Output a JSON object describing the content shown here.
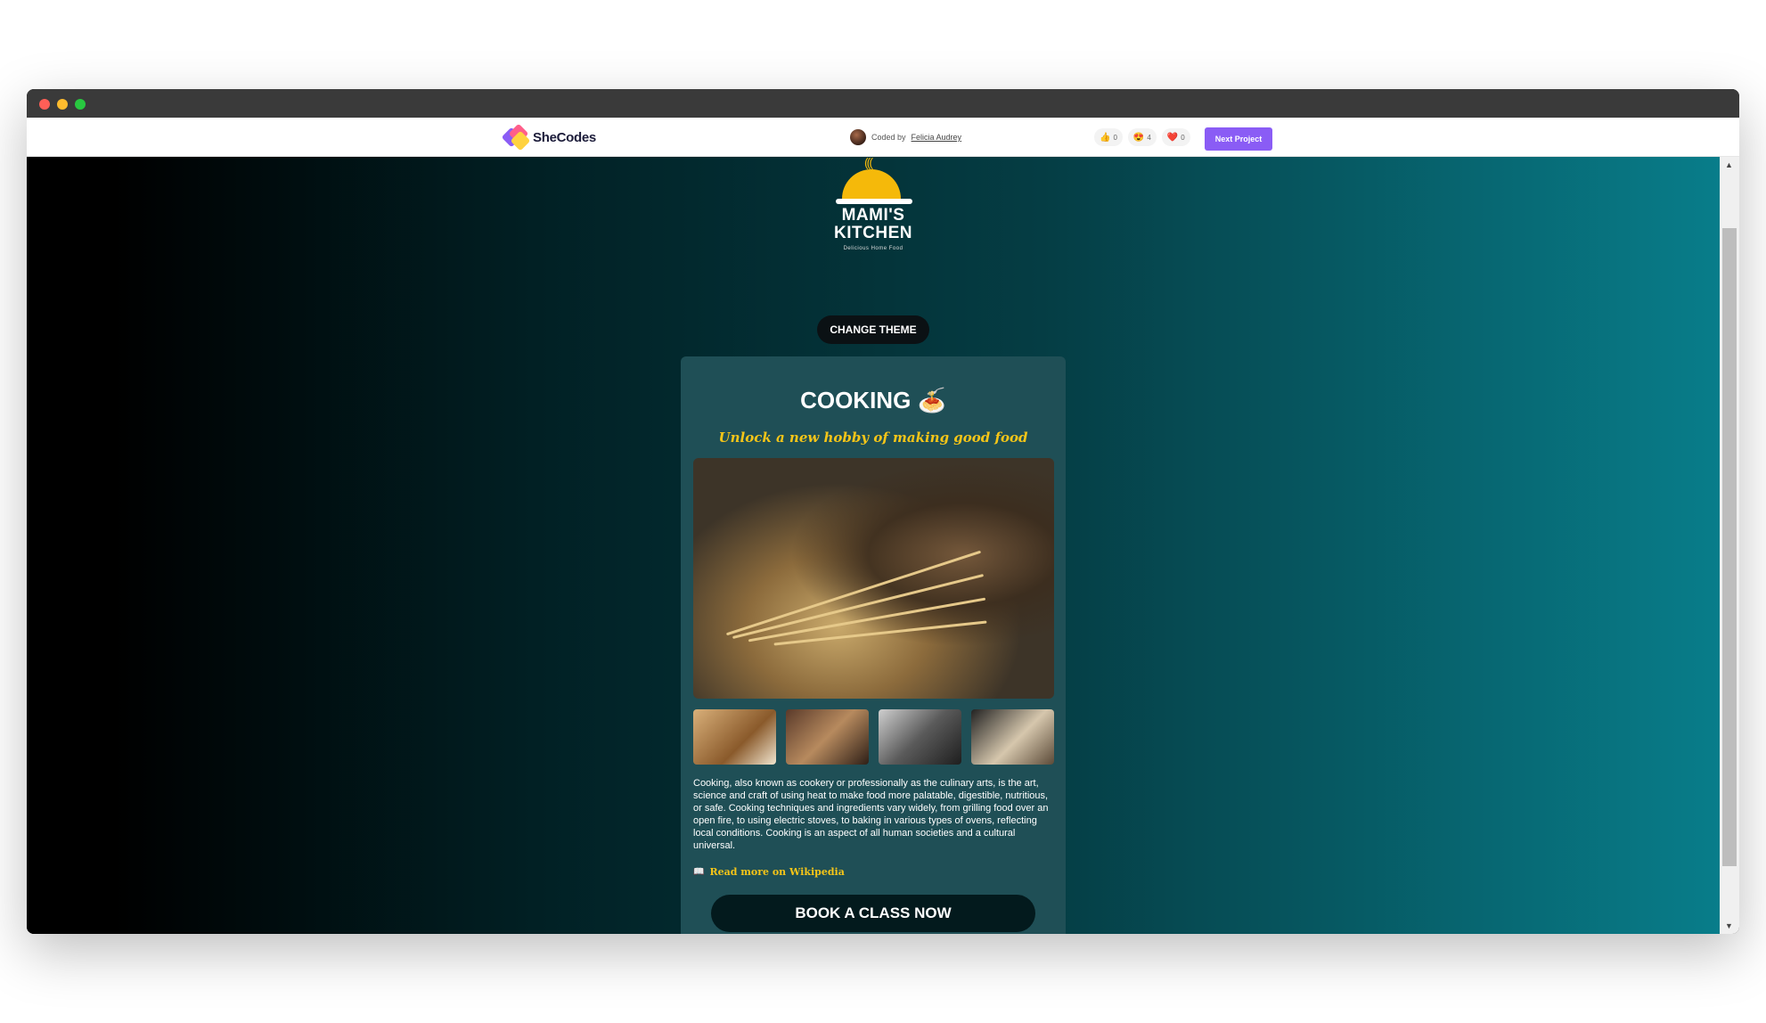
{
  "shecodes": {
    "logo_text": "SheCodes",
    "coded_by_prefix": "Coded by",
    "author": "Felicia Audrey",
    "reactions": [
      {
        "icon": "thumbs-up-icon",
        "emoji": "👍",
        "count": "0"
      },
      {
        "icon": "heart-eyes-icon",
        "emoji": "😍",
        "count": "4"
      },
      {
        "icon": "heart-icon",
        "emoji": "❤️",
        "count": "0"
      }
    ],
    "next_label": "Next Project"
  },
  "brand": {
    "steam": "(((",
    "name_line1": "MAMI'S",
    "name_line2": "KITCHEN",
    "tagline": "Delicious Home Food"
  },
  "theme_button": "CHANGE THEME",
  "card": {
    "title": "COOKING 🍝",
    "subtitle": "Unlock a new hobby of making good food",
    "description": "Cooking, also known as cookery or professionally as the culinary arts, is the art, science and craft of using heat to make food more palatable, digestible, nutritious, or safe. Cooking techniques and ingredients vary widely, from grilling food over an open fire, to using electric stoves, to baking in various types of ovens, reflecting local conditions. Cooking is an aspect of all human societies and a cultural universal.",
    "wiki_icon": "📖",
    "wiki_label": "Read more on Wikipedia",
    "cta": "BOOK A CLASS NOW"
  },
  "scrollbar": {
    "up": "▲",
    "down": "▼"
  }
}
